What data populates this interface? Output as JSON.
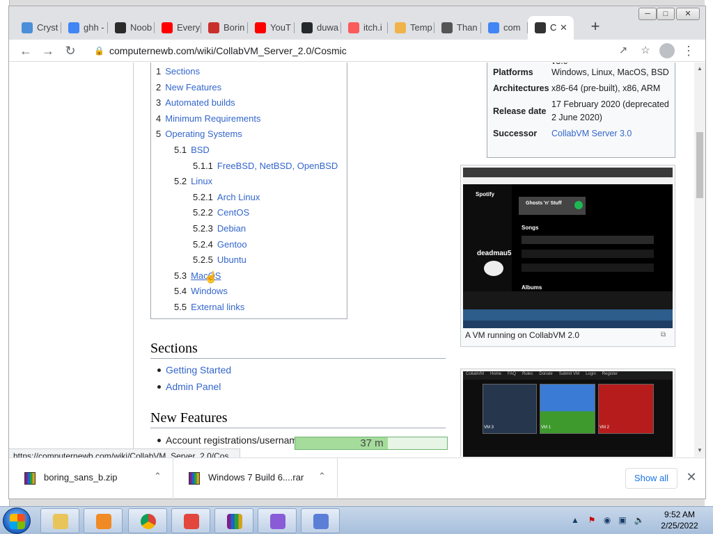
{
  "browser": {
    "tabs": [
      {
        "label": "Cryst",
        "icon": "crystal-icon",
        "color": "#4a8fd8"
      },
      {
        "label": "ghh -",
        "icon": "google-icon",
        "color": "#4285f4"
      },
      {
        "label": "Noob",
        "icon": "noob-icon",
        "color": "#2b2b2b"
      },
      {
        "label": "Every",
        "icon": "youtube-icon",
        "color": "#ff0000"
      },
      {
        "label": "Borin",
        "icon": "boring-icon",
        "color": "#c9302c"
      },
      {
        "label": "YouT",
        "icon": "youtube-icon",
        "color": "#ff0000"
      },
      {
        "label": "duwa",
        "icon": "github-icon",
        "color": "#24292e"
      },
      {
        "label": "itch.i",
        "icon": "itch-icon",
        "color": "#fa5c5c"
      },
      {
        "label": "Temp",
        "icon": "temp-icon",
        "color": "#f0b34a"
      },
      {
        "label": "Than",
        "icon": "globe-icon",
        "color": "#555555"
      },
      {
        "label": "com",
        "icon": "google-icon",
        "color": "#4285f4"
      },
      {
        "label": "C",
        "icon": "collabvm-icon",
        "color": "#333333"
      }
    ],
    "url": "computernewb.com/wiki/CollabVM_Server_2.0/Cosmic",
    "status_url": "https://computernewb.com/wiki/CollabVM_Server_2.0/Cos..."
  },
  "toc": {
    "items": [
      {
        "num": "1",
        "label": "Sections",
        "level": 1
      },
      {
        "num": "2",
        "label": "New Features",
        "level": 1
      },
      {
        "num": "3",
        "label": "Automated builds",
        "level": 1
      },
      {
        "num": "4",
        "label": "Minimum Requirements",
        "level": 1
      },
      {
        "num": "5",
        "label": "Operating Systems",
        "level": 1
      },
      {
        "num": "5.1",
        "label": "BSD",
        "level": 2
      },
      {
        "num": "5.1.1",
        "label": "FreeBSD, NetBSD, OpenBSD",
        "level": 3
      },
      {
        "num": "5.2",
        "label": "Linux",
        "level": 2
      },
      {
        "num": "5.2.1",
        "label": "Arch Linux",
        "level": 3
      },
      {
        "num": "5.2.2",
        "label": "CentOS",
        "level": 3
      },
      {
        "num": "5.2.3",
        "label": "Debian",
        "level": 3
      },
      {
        "num": "5.2.4",
        "label": "Gentoo",
        "level": 3
      },
      {
        "num": "5.2.5",
        "label": "Ubuntu",
        "level": 3
      },
      {
        "num": "5.3",
        "label": "MacOS",
        "level": 2
      },
      {
        "num": "5.4",
        "label": "Windows",
        "level": 2
      },
      {
        "num": "5.5",
        "label": "External links",
        "level": 2
      }
    ]
  },
  "infobox": {
    "top_fragment": "v3.0",
    "rows": [
      {
        "key": "Platforms",
        "value": "Windows, Linux, MacOS, BSD"
      },
      {
        "key": "Architectures",
        "value": "x86-64 (pre-built), x86, ARM"
      },
      {
        "key": "Release date",
        "value": "17 February 2020 (deprecated 2 June 2020)"
      },
      {
        "key": "Successor",
        "value": "CollabVM Server 3.0"
      }
    ]
  },
  "thumb1": {
    "caption": "A VM running on CollabVM 2.0",
    "screen": {
      "app": "Spotify",
      "track": "Ghosts 'n' Stuff",
      "section_songs": "Songs",
      "section_albums": "Albums",
      "artist_logo": "deadmau5"
    }
  },
  "thumb2": {
    "nav": [
      "CollabVM",
      "Home",
      "FAQ",
      "Rules",
      "Donate",
      "Submit VM",
      "Login",
      "Register"
    ],
    "vms": [
      "VM 3",
      "VM 1",
      "VM 2"
    ]
  },
  "sections": {
    "heading": "Sections",
    "items": [
      "Getting Started",
      "Admin Panel"
    ]
  },
  "features": {
    "heading": "New Features",
    "items": [
      "Account registrations/username reservations"
    ]
  },
  "overlay": {
    "text": "37 m",
    "progress": 0.61
  },
  "downloads": {
    "items": [
      "boring_sans_b.zip",
      "Windows 7 Build 6....rar"
    ],
    "show_all": "Show all"
  },
  "clock": {
    "time": "9:52 AM",
    "date": "2/25/2022"
  },
  "colors": {
    "link": "#3366cc",
    "accent": "#1a73e8"
  }
}
